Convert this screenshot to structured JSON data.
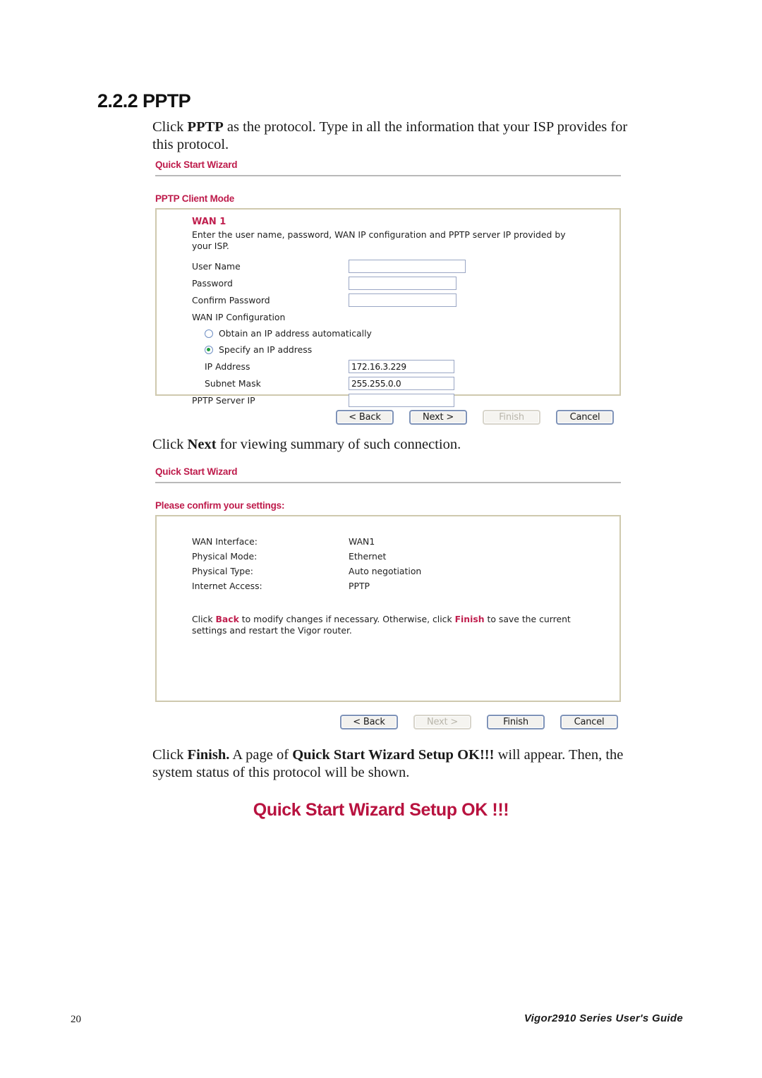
{
  "section": {
    "heading": "2.2.2 PPTP"
  },
  "intro_paragraph": {
    "prefix": "Click ",
    "bold": "PPTP",
    "suffix": " as the protocol. Type in all the information that your ISP provides for this protocol."
  },
  "wizard_step1": {
    "title": "Quick Start Wizard",
    "mode_title": "PPTP Client Mode",
    "wan_label": "WAN 1",
    "description": "Enter the user name, password, WAN IP configuration and PPTP server IP provided by your ISP.",
    "fields": {
      "user_name_label": "User Name",
      "user_name_value": "",
      "password_label": "Password",
      "password_value": "",
      "confirm_password_label": "Confirm Password",
      "confirm_password_value": "",
      "wan_ip_config_label": "WAN IP Configuration",
      "radio_obtain_label": "Obtain an IP address automatically",
      "radio_specify_label": "Specify an IP address",
      "ip_address_label": "IP Address",
      "ip_address_value": "172.16.3.229",
      "subnet_mask_label": "Subnet Mask",
      "subnet_mask_value": "255.255.0.0",
      "pptp_server_ip_label": "PPTP Server IP",
      "pptp_server_ip_value": ""
    },
    "selected_radio": "specify",
    "buttons": {
      "back": "< Back",
      "next": "Next >",
      "finish": "Finish",
      "cancel": "Cancel",
      "disabled": [
        "finish"
      ]
    }
  },
  "mid_paragraph": {
    "prefix": "Click ",
    "bold": "Next",
    "suffix": " for viewing summary of such connection."
  },
  "wizard_step2": {
    "title": "Quick Start Wizard",
    "confirm_title": "Please confirm your settings:",
    "summary": [
      {
        "key": "WAN Interface:",
        "value": "WAN1"
      },
      {
        "key": "Physical Mode:",
        "value": "Ethernet"
      },
      {
        "key": "Physical Type:",
        "value": "Auto negotiation"
      },
      {
        "key": "Internet Access:",
        "value": "PPTP"
      }
    ],
    "hint": {
      "part1": "Click ",
      "bold1": "Back",
      "part2": " to modify changes if necessary. Otherwise, click ",
      "bold2": "Finish",
      "part3": " to save the current settings and restart the Vigor router."
    },
    "buttons": {
      "back": "< Back",
      "next": "Next >",
      "finish": "Finish",
      "cancel": "Cancel",
      "disabled": [
        "next"
      ]
    }
  },
  "closing_paragraph": {
    "part1": "Click ",
    "bold1": "Finish.",
    "part2": " A page of ",
    "bold2": "Quick Start Wizard Setup OK!!!",
    "part3": " will appear. Then, the system status of this protocol will be shown."
  },
  "ok_heading": "Quick Start Wizard Setup OK !!!",
  "footer": {
    "page_number": "20",
    "guide": "Vigor2910 Series User's Guide"
  },
  "colors": {
    "accent_red": "#BE1B4B",
    "heading_red": "#B8123F",
    "panel_border": "#cfc9ae",
    "input_border": "#9aa6c4",
    "rule_grey": "#b9b9b9",
    "radio_selected_green": "#1e9e3e"
  }
}
